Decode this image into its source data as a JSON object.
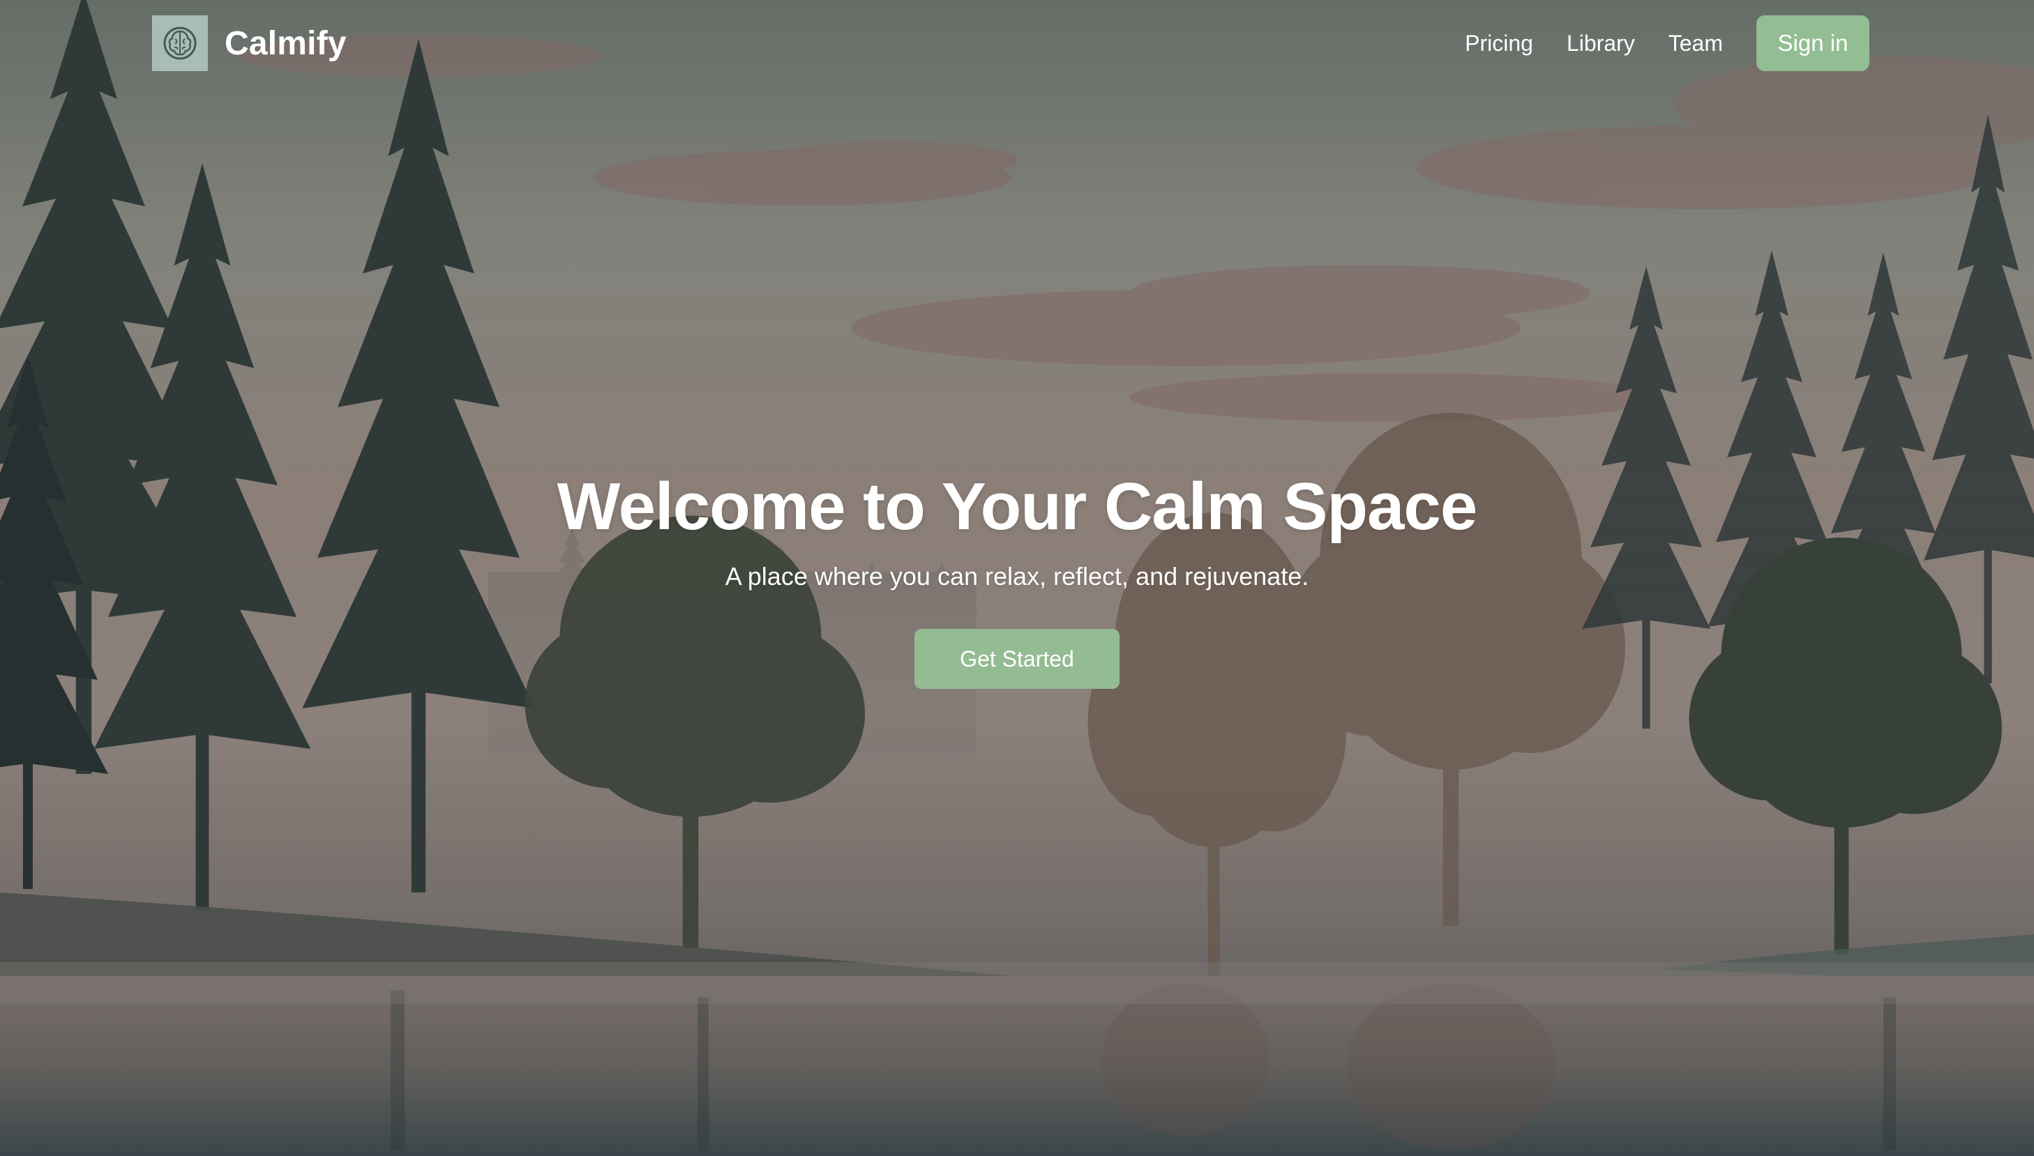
{
  "brand": {
    "name": "Calmify",
    "logo_icon": "brain-icon"
  },
  "nav": {
    "links": [
      "Pricing",
      "Library",
      "Team"
    ],
    "signin_label": "Sign in",
    "accent": "#93bd92"
  },
  "hero": {
    "title": "Welcome to Your Calm Space",
    "subtitle": "A place where you can relax, reflect, and rejuvenate.",
    "cta_label": "Get Started"
  },
  "background": {
    "scene": "misty-forest-lake"
  }
}
